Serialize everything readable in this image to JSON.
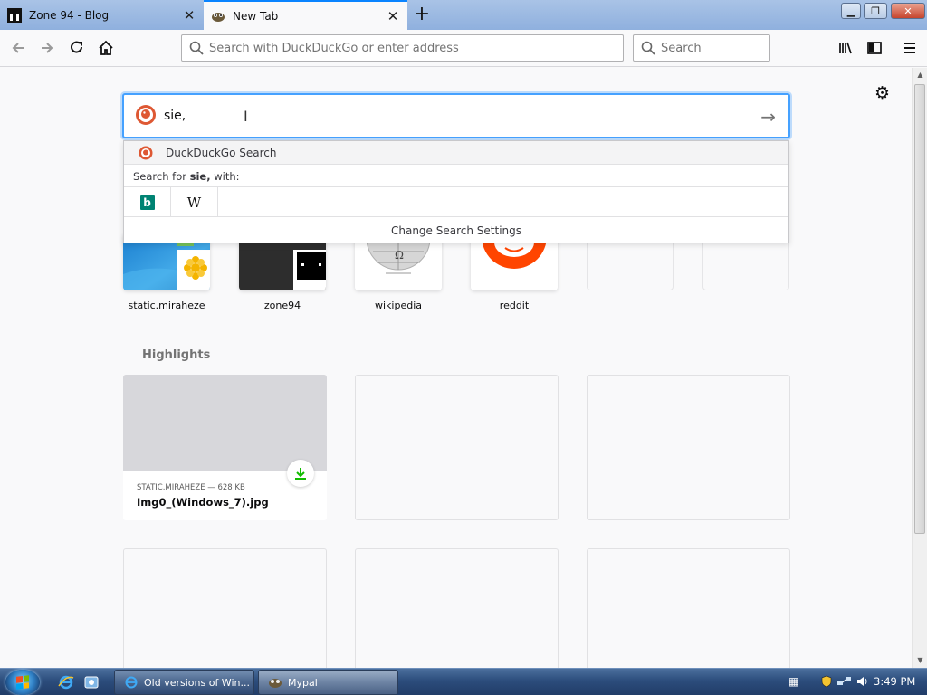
{
  "browser": {
    "tabs": [
      {
        "title": "Zone 94 - Blog",
        "favicon": "zone94-icon",
        "active": false
      },
      {
        "title": "New Tab",
        "favicon": "mypal-icon",
        "active": true
      }
    ],
    "new_tab_icon": "plus-icon",
    "urlbar_placeholder": "Search with DuckDuckGo or enter address",
    "searchbar_placeholder": "Search"
  },
  "newtab": {
    "search": {
      "value": "sie,",
      "engine_icon": "duckduckgo-icon",
      "suggestion_label": "DuckDuckGo Search",
      "search_for_prefix": "Search for ",
      "search_for_term": "sie,",
      "search_for_suffix": " with:",
      "engines": [
        "bing-icon",
        "wikipedia-icon"
      ],
      "change_settings": "Change Search Settings"
    },
    "top_sites": [
      {
        "label": "static.miraheze"
      },
      {
        "label": "zone94"
      },
      {
        "label": "wikipedia"
      },
      {
        "label": "reddit"
      },
      {
        "label": ""
      },
      {
        "label": ""
      }
    ],
    "highlights_title": "Highlights",
    "highlight_card": {
      "meta": "STATIC.MIRAHEZE — 628 KB",
      "title": "Img0_(Windows_7).jpg"
    }
  },
  "taskbar": {
    "tasks": [
      {
        "label": "Old versions of Win...",
        "icon": "ie-icon"
      },
      {
        "label": "Mypal",
        "icon": "mypal-icon"
      }
    ],
    "clock": "3:49 PM"
  },
  "colors": {
    "accent": "#0a84ff",
    "reddit": "#ff4500",
    "download_green": "#12bc00"
  }
}
